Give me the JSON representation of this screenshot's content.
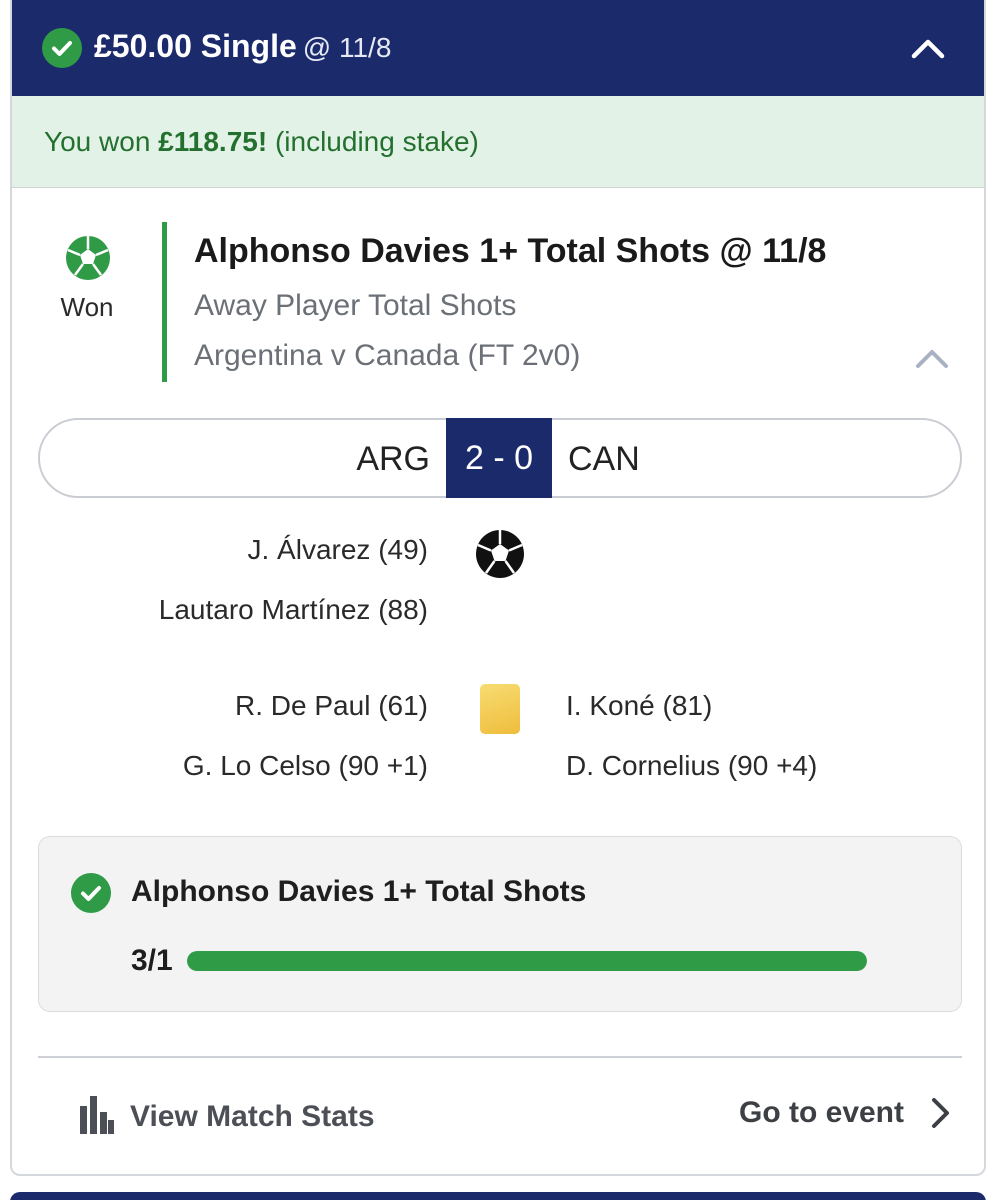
{
  "bet": {
    "stake_label": "£50.00 Single",
    "odds_label": "@ 11/8"
  },
  "result": {
    "prefix": "You won ",
    "amount": "£118.75!",
    "suffix": " (including stake)"
  },
  "leg": {
    "status": "Won",
    "title": "Alphonso Davies 1+ Total Shots @ 11/8",
    "market": "Away Player Total Shots",
    "event": "Argentina v Canada (FT 2v0)"
  },
  "scoreboard": {
    "home": "ARG",
    "score": "2 - 0",
    "away": "CAN"
  },
  "events": {
    "goals_home": [
      "J. Álvarez (49)",
      "Lautaro Martínez (88)"
    ],
    "cards_home": [
      "R. De Paul (61)",
      "G. Lo Celso (90 +1)"
    ],
    "cards_away": [
      "I. Koné (81)",
      "D. Cornelius (90 +4)"
    ]
  },
  "progress": {
    "title": "Alphonso Davies 1+ Total Shots",
    "count": "3/1",
    "fraction": 1.0
  },
  "footer": {
    "stats_label": "View Match Stats",
    "event_label": "Go to event"
  },
  "colors": {
    "header": "#1b2a6b",
    "win_green": "#2f9b47",
    "banner_bg": "#e3f2e6"
  }
}
